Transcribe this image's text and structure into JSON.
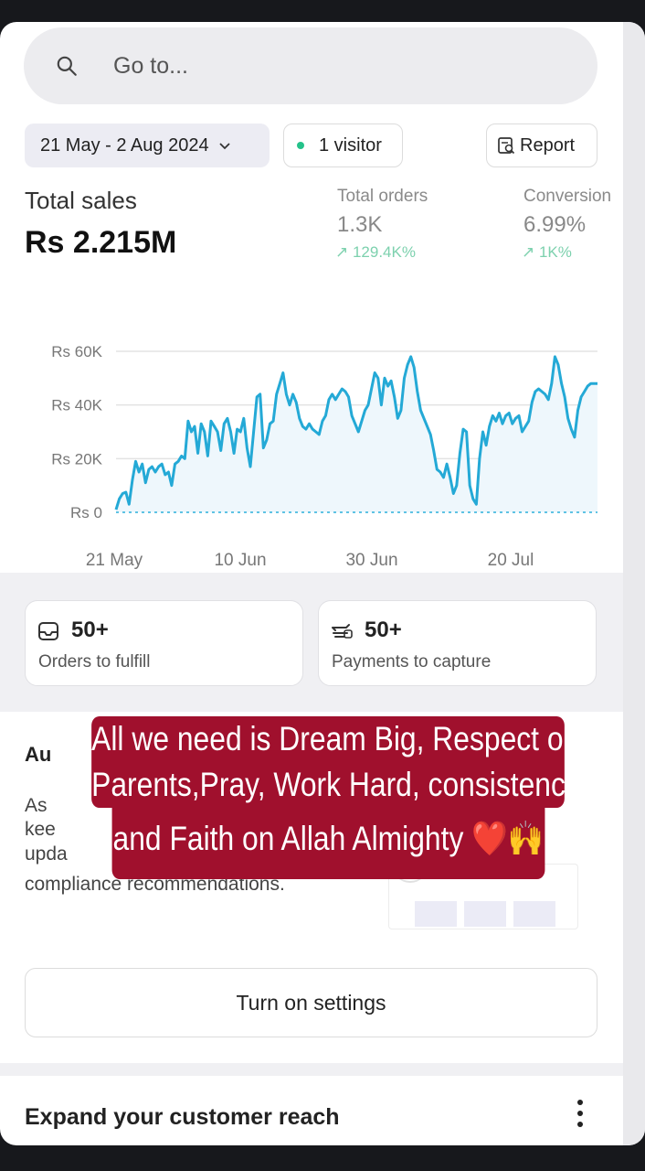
{
  "search": {
    "placeholder": "Go to..."
  },
  "filters": {
    "date_range": "21 May - 2 Aug 2024",
    "visitors": "1 visitor",
    "report_label": "Report"
  },
  "metrics": {
    "total_sales_label": "Total sales",
    "total_sales_value": "Rs 2.215M",
    "total_orders_label": "Total orders",
    "total_orders_value": "1.3K",
    "total_orders_trend": "↗ 129.4K%",
    "conversion_label": "Conversion",
    "conversion_value": "6.99%",
    "conversion_trend": "↗ 1K%"
  },
  "chart_data": {
    "type": "line",
    "title": "",
    "xlabel": "",
    "ylabel": "",
    "y_ticks": [
      "Rs 60K",
      "Rs 40K",
      "Rs 20K",
      "Rs 0"
    ],
    "x_ticks": [
      "21 May",
      "10 Jun",
      "30 Jun",
      "20 Jul"
    ],
    "ylim": [
      0,
      60000
    ],
    "grid": true,
    "series": [
      {
        "values": [
          1000,
          5000,
          7000,
          7500,
          3000,
          12000,
          19000,
          15000,
          18000,
          11000,
          16000,
          17000,
          15000,
          17000,
          18000,
          14000,
          15000,
          10000,
          18000,
          19000,
          21000,
          20000,
          34000,
          30000,
          32000,
          22000,
          33000,
          30000,
          21000,
          34000,
          32000,
          30000,
          23000,
          33000,
          35000,
          30000,
          22000,
          31000,
          30000,
          35000,
          24000,
          17000,
          30000,
          43000,
          44000,
          24000,
          27000,
          33000,
          34000,
          44000,
          48000,
          52000,
          44000,
          40000,
          44000,
          41000,
          35000,
          32000,
          31000,
          33000,
          31000,
          30000,
          29000,
          34000,
          36000,
          42000,
          44000,
          42000,
          44000,
          46000,
          45000,
          43000,
          36000,
          33000,
          30000,
          34000,
          38000,
          40000,
          46000,
          52000,
          50000,
          40000,
          50000,
          47000,
          49000,
          43000,
          35000,
          38000,
          50000,
          55000,
          58000,
          54000,
          45000,
          38000,
          35000,
          32000,
          29000,
          23000,
          16000,
          15000,
          13000,
          18000,
          13000,
          7000,
          10000,
          22000,
          31000,
          30000,
          10000,
          5000,
          3000,
          20000,
          30000,
          25000,
          32000,
          36000,
          34000,
          37000,
          33000,
          36000,
          37000,
          33000,
          35000,
          36000,
          30000,
          32000,
          34000,
          41000,
          45000,
          46000,
          45000,
          44000,
          42000,
          48000,
          58000,
          55000,
          48000,
          43000,
          35000,
          31000,
          28000,
          38000,
          43000,
          45000,
          47000,
          48000,
          48000,
          48000
        ],
        "color": "#24a9d6"
      },
      {
        "values": [
          0,
          0
        ],
        "style": "dotted",
        "color": "#5fc3e4"
      }
    ]
  },
  "cards": {
    "orders_value": "50+",
    "orders_label": "Orders to fulfill",
    "payments_value": "50+",
    "payments_label": "Payments to capture"
  },
  "automation": {
    "title_fragment": "Au",
    "body_line1": "As",
    "body_line2": "kee",
    "body_line3": "upda",
    "body_line4": "compliance recommendations."
  },
  "overlay": {
    "line1": "All we need is Dream Big, Respect our",
    "line2": "Parents,Pray, Work Hard, consistency",
    "line3": "and Faith on Allah Almighty ❤️🙌"
  },
  "settings_button": "Turn on settings",
  "expand_section": {
    "title": "Expand your customer reach"
  }
}
